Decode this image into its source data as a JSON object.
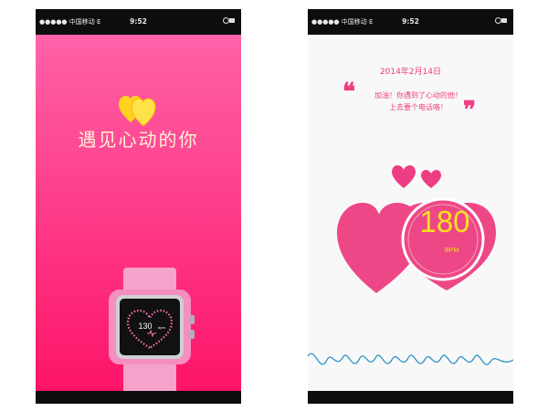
{
  "status_bar": {
    "carrier": "●●●●● 中国移动  E",
    "time": "9:52",
    "battery_icon": "battery-icon"
  },
  "left_screen": {
    "logo_icon": "double-heart-logo-icon",
    "tagline": "遇见心动的你",
    "watch": {
      "bpm_value": "130",
      "bpm_unit": "bpm"
    }
  },
  "right_screen": {
    "date": "2014年2月14日",
    "message_lines": [
      "加油！你遇到了心动的他！",
      "上去要个电话咯！"
    ],
    "quote_open": "❝",
    "quote_close": "❞",
    "heart_rate": "180",
    "heart_rate_unit": "BPM"
  },
  "colors": {
    "pink": "#fd1468",
    "accent": "#ee3d82",
    "yellow": "#f6e21a"
  }
}
